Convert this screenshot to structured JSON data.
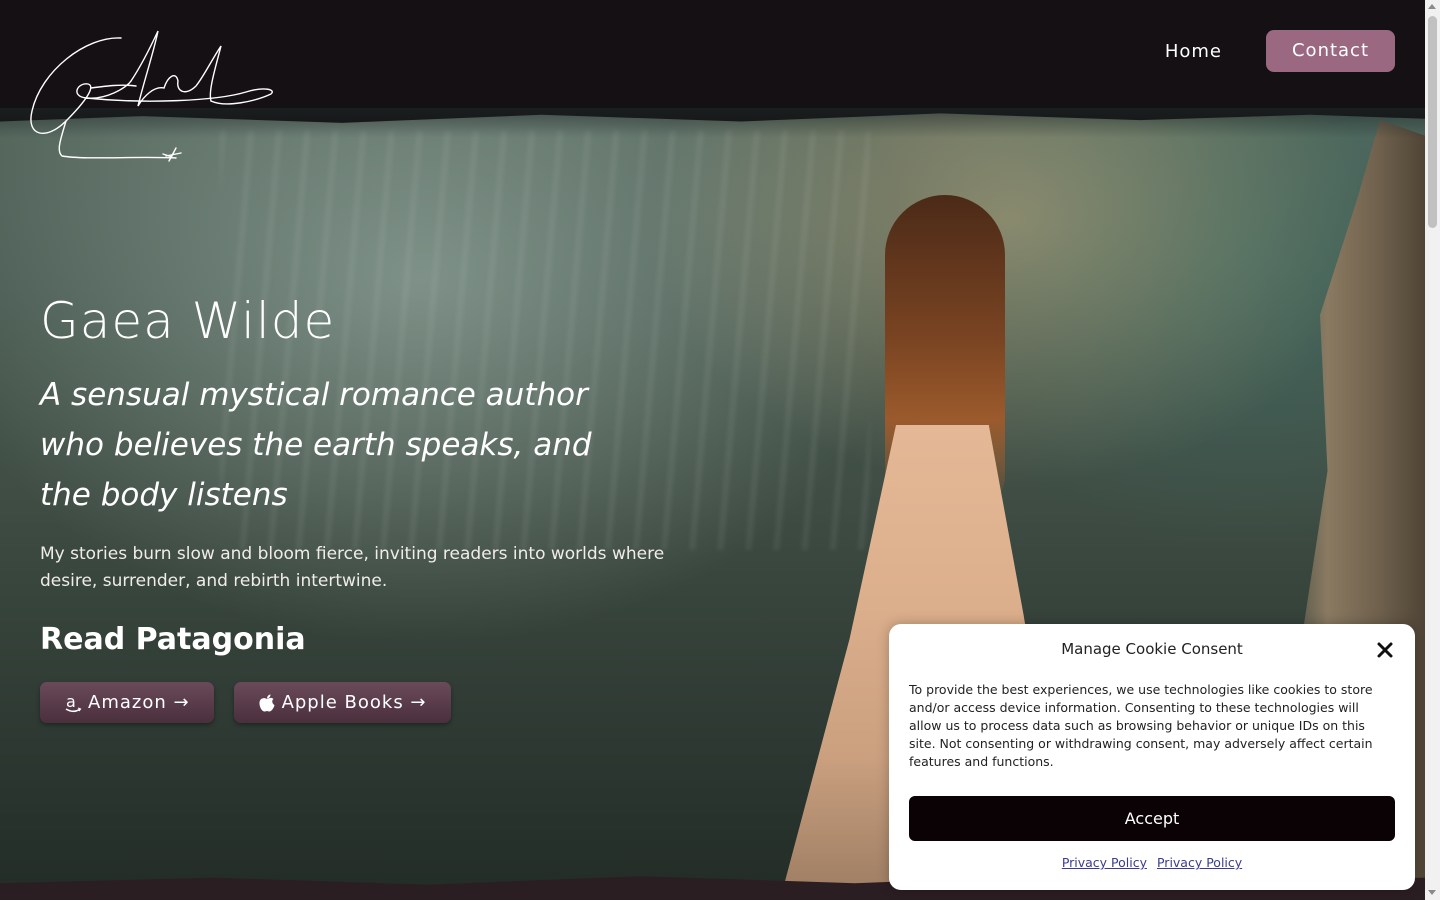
{
  "header": {
    "logo_text": "Gaea Wilde",
    "nav": {
      "home_label": "Home",
      "contact_label": "Contact"
    }
  },
  "hero": {
    "title": "Gaea Wilde",
    "tagline": "A sensual mystical romance author who believes the earth speaks, and the body listens",
    "description": "My stories burn slow and bloom fierce, inviting readers into worlds where desire, surrender, and rebirth intertwine.",
    "read_heading": "Read Patagonia",
    "buttons": {
      "amazon_label": "Amazon →",
      "amazon_icon": "amazon-icon",
      "apple_label": "Apple Books →",
      "apple_icon": "apple-icon"
    }
  },
  "cookie_consent": {
    "title": "Manage Cookie Consent",
    "body": "To provide the best experiences, we use technologies like cookies to store and/or access device information. Consenting to these technologies will allow us to process data such as browsing behavior or unique IDs on this site. Not consenting or withdrawing consent, may adversely affect certain features and functions.",
    "accept_label": "Accept",
    "links": [
      "Privacy Policy",
      "Privacy Policy"
    ]
  },
  "colors": {
    "accent": "#9b6882",
    "button_dark": "#4a2f3d",
    "header_bg": "#141013",
    "accept_bg": "#0b0205"
  }
}
